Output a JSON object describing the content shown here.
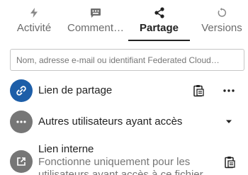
{
  "tabs": [
    {
      "label": "Activité",
      "icon": "lightning-icon",
      "active": false
    },
    {
      "label": "Comment…",
      "icon": "comment-icon",
      "active": false
    },
    {
      "label": "Partage",
      "icon": "share-icon",
      "active": true
    },
    {
      "label": "Versions",
      "icon": "history-icon",
      "active": false
    }
  ],
  "search": {
    "placeholder": "Nom, adresse e-mail ou identifiant Federated Cloud…",
    "value": ""
  },
  "share_link": {
    "label": "Lien de partage",
    "avatar_icon": "link-icon",
    "copy_icon": "clipboard-icon",
    "menu_icon": "more-horizontal-icon"
  },
  "others_access": {
    "label": "Autres utilisateurs ayant accès",
    "avatar_icon": "more-horizontal-icon",
    "expand_icon": "triangle-down-icon"
  },
  "internal_link": {
    "label": "Lien interne",
    "description_line1": "Fonctionne uniquement pour les",
    "description_line2": "utilisateurs ayant accès à ce fichier",
    "avatar_icon": "open-in-new-icon",
    "copy_icon": "clipboard-icon"
  },
  "colors": {
    "primary": "#1d5ea8",
    "avatar_grey": "#767676",
    "text": "#222222",
    "text_muted": "#767676",
    "tab_inactive": "#6b6b6b",
    "border": "#c6c6c6"
  }
}
